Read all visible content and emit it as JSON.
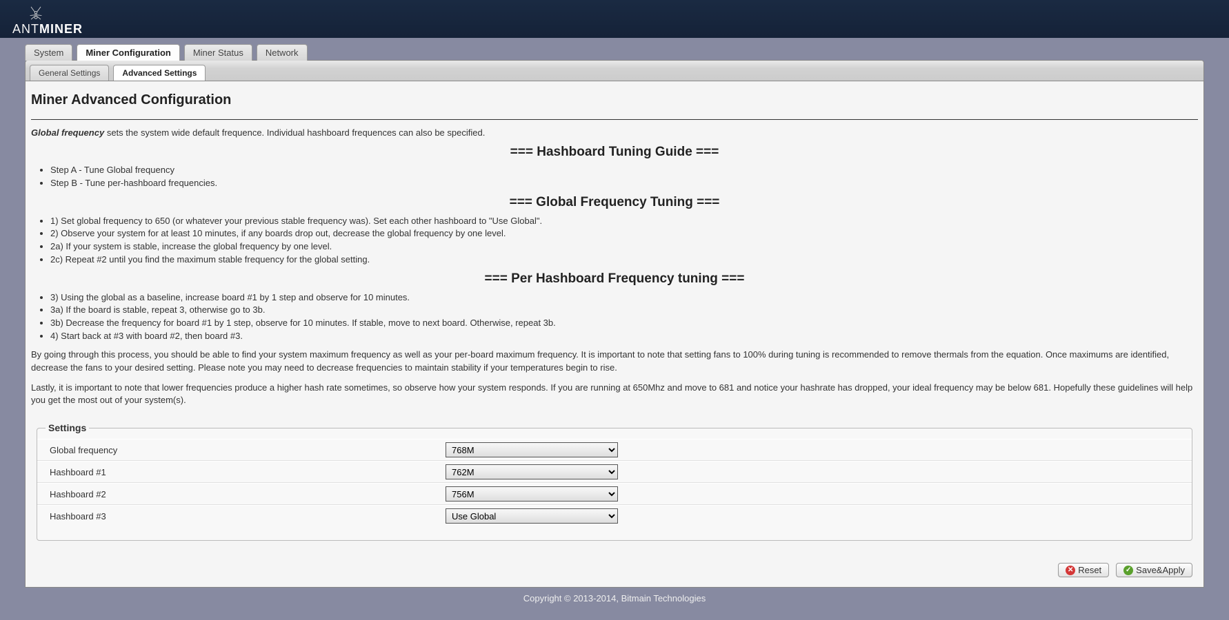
{
  "brand": {
    "prefix": "ANT",
    "suffix": "MINER"
  },
  "tabs_primary": [
    {
      "label": "System",
      "active": false
    },
    {
      "label": "Miner Configuration",
      "active": true
    },
    {
      "label": "Miner Status",
      "active": false
    },
    {
      "label": "Network",
      "active": false
    }
  ],
  "tabs_secondary": [
    {
      "label": "General Settings",
      "active": false
    },
    {
      "label": "Advanced Settings",
      "active": true
    }
  ],
  "page_title": "Miner Advanced Configuration",
  "intro": {
    "em": "Global frequency",
    "rest": " sets the system wide default frequence. Individual hashboard frequences can also be specified."
  },
  "guide": {
    "h1": "=== Hashboard Tuning Guide ===",
    "steps_ab": [
      "Step A - Tune Global frequency",
      "Step B - Tune per-hashboard frequencies."
    ],
    "h2": "=== Global Frequency Tuning ===",
    "steps_global": [
      "1) Set global frequency to 650 (or whatever your previous stable frequency was). Set each other hashboard to \"Use Global\".",
      "2) Observe your system for at least 10 minutes, if any boards drop out, decrease the global frequency by one level.",
      "2a) If your system is stable, increase the global frequency by one level.",
      "2c) Repeat #2 until you find the maximum stable frequency for the global setting."
    ],
    "h3": "=== Per Hashboard Frequency tuning ===",
    "steps_per": [
      "3) Using the global as a baseline, increase board #1 by 1 step and observe for 10 minutes.",
      "3a) If the board is stable, repeat 3, otherwise go to 3b.",
      "3b) Decrease the frequency for board #1 by 1 step, observe for 10 minutes. If stable, move to next board. Otherwise, repeat 3b.",
      "4) Start back at #3 with board #2, then board #3."
    ],
    "p1": "By going through this process, you should be able to find your system maximum frequency as well as your per-board maximum frequency. It is important to note that setting fans to 100% during tuning is recommended to remove thermals from the equation. Once maximums are identified, decrease the fans to your desired setting. Please note you may need to decrease frequencies to maintain stability if your temperatures begin to rise.",
    "p2": "Lastly, it is important to note that lower frequencies produce a higher hash rate sometimes, so observe how your system responds. If you are running at 650Mhz and move to 681 and notice your hashrate has dropped, your ideal frequency may be below 681. Hopefully these guidelines will help you get the most out of your system(s)."
  },
  "settings": {
    "legend": "Settings",
    "rows": [
      {
        "label": "Global frequency",
        "value": "768M"
      },
      {
        "label": "Hashboard #1",
        "value": "762M"
      },
      {
        "label": "Hashboard #2",
        "value": "756M"
      },
      {
        "label": "Hashboard #3",
        "value": "Use Global"
      }
    ]
  },
  "buttons": {
    "reset": "Reset",
    "save": "Save&Apply"
  },
  "footer": "Copyright © 2013-2014, Bitmain Technologies"
}
